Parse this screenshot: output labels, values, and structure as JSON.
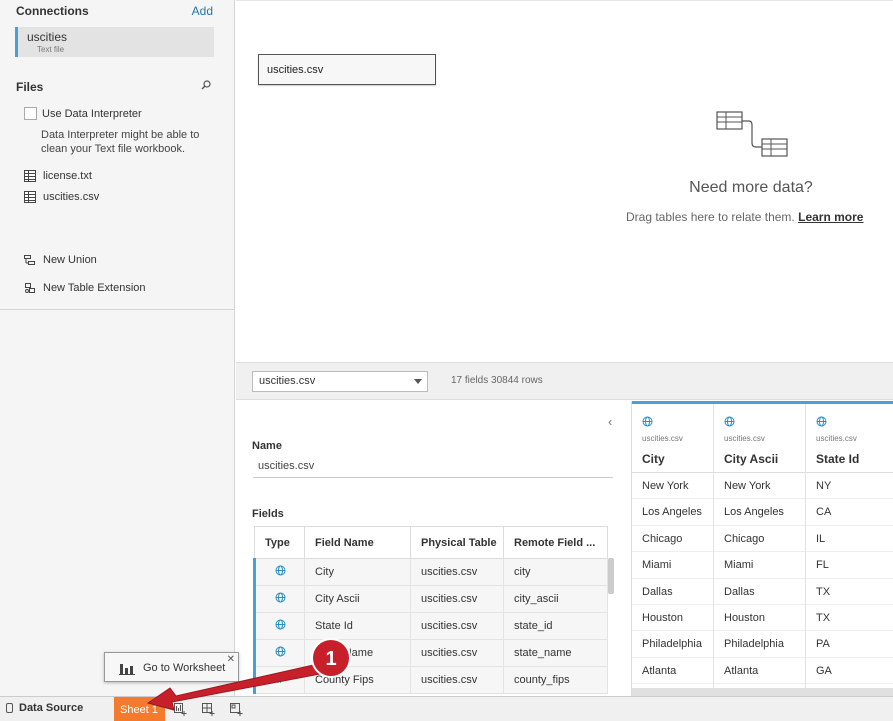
{
  "sidebar": {
    "connections_title": "Connections",
    "add_label": "Add",
    "connection": {
      "name": "uscities",
      "type": "Text file"
    },
    "files_title": "Files",
    "interpreter_label": "Use Data Interpreter",
    "interpreter_desc": "Data Interpreter might be able to clean your Text file workbook.",
    "files": [
      "license.txt",
      "uscities.csv"
    ],
    "new_union": "New Union",
    "new_table_extension": "New Table Extension"
  },
  "canvas": {
    "table_name": "uscities.csv",
    "need_more_title": "Need more data?",
    "need_more_sub": "Drag tables here to relate them.",
    "learn_more": "Learn more"
  },
  "toolbar": {
    "selected_table": "uscities.csv",
    "field_count": "17 fields 30844 rows"
  },
  "metadata": {
    "name_label": "Name",
    "name_value": "uscities.csv",
    "fields_label": "Fields",
    "columns": [
      "Type",
      "Field Name",
      "Physical Table",
      "Remote Field ..."
    ],
    "rows": [
      [
        "City",
        "uscities.csv",
        "city"
      ],
      [
        "City Ascii",
        "uscities.csv",
        "city_ascii"
      ],
      [
        "State Id",
        "uscities.csv",
        "state_id"
      ],
      [
        "State Name",
        "uscities.csv",
        "state_name"
      ],
      [
        "County Fips",
        "uscities.csv",
        "county_fips"
      ]
    ]
  },
  "grid": {
    "source": "uscities.csv",
    "columns": [
      {
        "name": "City",
        "values": [
          "New York",
          "Los Angeles",
          "Chicago",
          "Miami",
          "Dallas",
          "Houston",
          "Philadelphia",
          "Atlanta"
        ]
      },
      {
        "name": "City Ascii",
        "values": [
          "New York",
          "Los Angeles",
          "Chicago",
          "Miami",
          "Dallas",
          "Houston",
          "Philadelphia",
          "Atlanta"
        ]
      },
      {
        "name": "State Id",
        "values": [
          "NY",
          "CA",
          "IL",
          "FL",
          "TX",
          "TX",
          "PA",
          "GA"
        ]
      }
    ]
  },
  "bottombar": {
    "data_source": "Data Source",
    "sheet": "Sheet 1"
  },
  "tooltip": {
    "label": "Go to Worksheet",
    "close": "✕"
  },
  "annotation": {
    "step": "1"
  },
  "colors": {
    "accent": "#4a9fd5",
    "sheet_tab": "#f47b2d",
    "annotation": "#c8202b"
  }
}
